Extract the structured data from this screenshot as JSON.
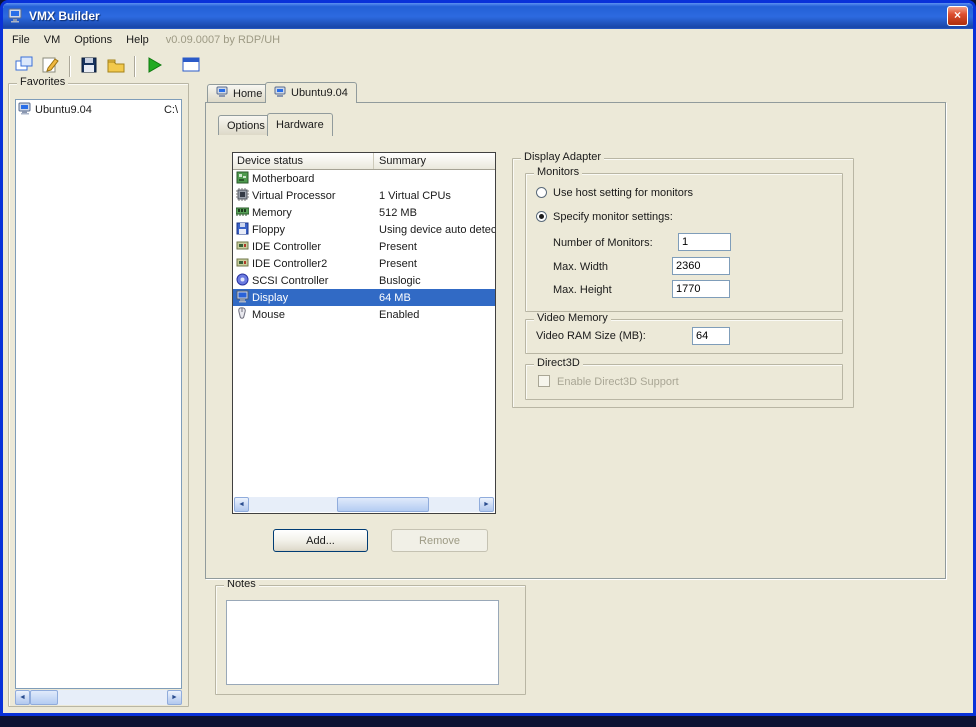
{
  "window": {
    "title": "VMX Builder",
    "close_label": "×"
  },
  "menu": {
    "items": [
      "File",
      "VM",
      "Options",
      "Help"
    ],
    "version": "v0.09.0007 by RDP/UH"
  },
  "toolbar": {
    "buttons": [
      "new-vm-icon",
      "edit-vm-icon",
      "save-icon",
      "open-folder-icon",
      "run-icon",
      "vm-window-icon"
    ]
  },
  "icons": {
    "left": "◄",
    "right": "►",
    "up": "▲",
    "down": "▼"
  },
  "favorites": {
    "label": "Favorites",
    "items": [
      {
        "name": "Ubuntu9.04",
        "path": "C:\\"
      }
    ]
  },
  "tabs": {
    "home": "Home",
    "vm": "Ubuntu9.04"
  },
  "subtabs": {
    "options": "Options",
    "hardware": "Hardware"
  },
  "hardware": {
    "columns": {
      "device": "Device status",
      "summary": "Summary"
    },
    "devices": [
      {
        "icon": "motherboard-icon",
        "name": "Motherboard",
        "summary": ""
      },
      {
        "icon": "processor-icon",
        "name": "Virtual Processor",
        "summary": "1 Virtual CPUs"
      },
      {
        "icon": "memory-icon",
        "name": "Memory",
        "summary": "512 MB"
      },
      {
        "icon": "floppy-icon",
        "name": "Floppy",
        "summary": "Using device auto detec"
      },
      {
        "icon": "ide-controller-icon",
        "name": "IDE Controller",
        "summary": "Present"
      },
      {
        "icon": "ide-controller-icon",
        "name": "IDE Controller2",
        "summary": "Present"
      },
      {
        "icon": "scsi-controller-icon",
        "name": "SCSI Controller",
        "summary": "Buslogic"
      },
      {
        "icon": "display-icon",
        "name": "Display",
        "summary": "64 MB",
        "selected": true
      },
      {
        "icon": "mouse-icon",
        "name": "Mouse",
        "summary": "Enabled"
      }
    ],
    "add_label": "Add...",
    "remove_label": "Remove"
  },
  "display_adapter": {
    "label": "Display Adapter",
    "monitors": {
      "label": "Monitors",
      "radio_host": "Use host setting for monitors",
      "radio_specify": "Specify monitor settings:",
      "num_label": "Number of Monitors:",
      "num_value": "1",
      "width_label": "Max. Width",
      "width_value": "2360",
      "height_label": "Max. Height",
      "height_value": "1770"
    },
    "video_memory": {
      "label": "Video Memory",
      "ram_label": "Video RAM Size (MB):",
      "ram_value": "64"
    },
    "direct3d": {
      "label": "Direct3D",
      "checkbox_label": "Enable Direct3D Support"
    }
  },
  "notes": {
    "label": "Notes",
    "value": ""
  }
}
